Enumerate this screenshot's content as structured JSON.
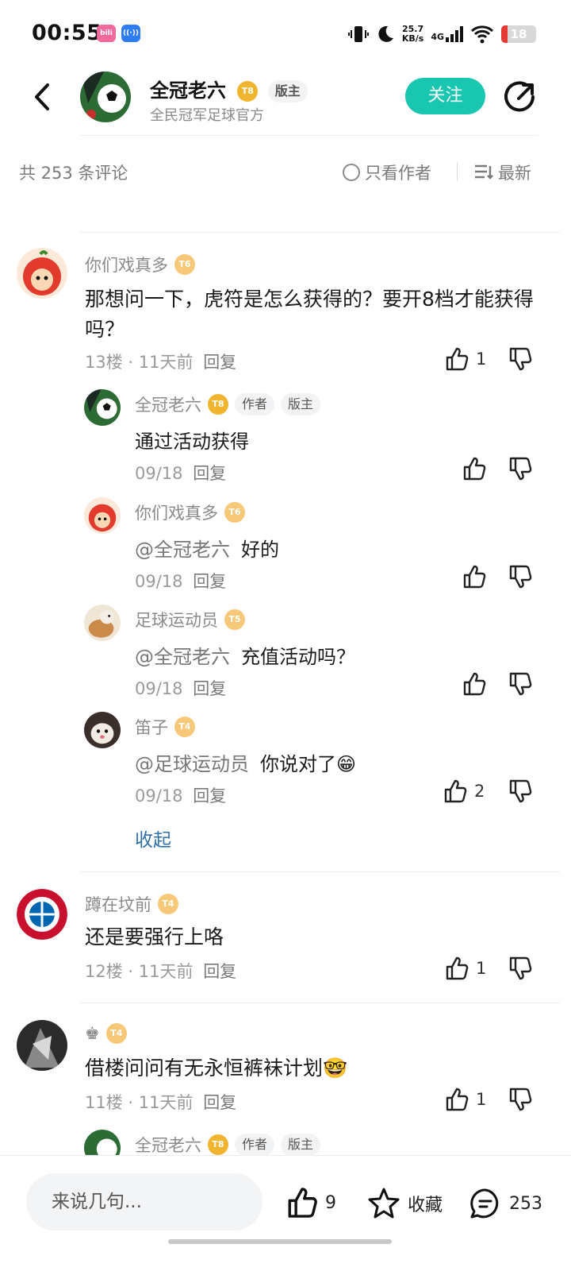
{
  "status_bar": {
    "time": "00:55",
    "apps": [
      "bilibili-icon",
      "hotspot-icon"
    ],
    "speed_value": "25.7",
    "speed_unit": "KB/s",
    "network": "4G",
    "battery": "18",
    "battery_level": 0.18,
    "battery_color": "#e53935"
  },
  "header": {
    "name": "全冠老六",
    "level_badge": "T8",
    "role_badge": "版主",
    "subtitle": "全民冠军足球官方",
    "follow_label": "关注",
    "accent": "#19c6b0"
  },
  "toolbar": {
    "count_text": "共 253 条评论",
    "only_author": "只看作者",
    "sort_label": "最新"
  },
  "comments": [
    {
      "user": "你们戏真多",
      "level": "T6",
      "text": "那想问一下，虎符是怎么获得的？要开8档才能获得吗？",
      "floor": "13楼",
      "time": "11天前",
      "reply_label": "回复",
      "likes": "1"
    },
    {
      "user": "蹲在坟前",
      "level": "T4",
      "text": "还是要强行上咯",
      "floor": "12楼",
      "time": "11天前",
      "reply_label": "回复",
      "likes": "1"
    },
    {
      "user": "♚",
      "level": "T4",
      "text": "借楼问问有无永恒裤袜计划🤓",
      "floor": "11楼",
      "time": "11天前",
      "reply_label": "回复",
      "likes": "1"
    }
  ],
  "replies": [
    {
      "user": "全冠老六",
      "level": "T8",
      "badges": [
        "作者",
        "版主"
      ],
      "at": "",
      "text": "通过活动获得",
      "date": "09/18",
      "reply_label": "回复",
      "likes": ""
    },
    {
      "user": "你们戏真多",
      "level": "T6",
      "badges": [],
      "at": "@全冠老六",
      "text": "好的",
      "date": "09/18",
      "reply_label": "回复",
      "likes": ""
    },
    {
      "user": "足球运动员",
      "level": "T5",
      "badges": [],
      "at": "@全冠老六",
      "text": "充值活动吗？",
      "date": "09/18",
      "reply_label": "回复",
      "likes": ""
    },
    {
      "user": "笛子",
      "level": "T4",
      "badges": [],
      "at": "@足球运动员",
      "text": "你说对了😁",
      "date": "09/18",
      "reply_label": "回复",
      "likes": "2"
    }
  ],
  "collapse_label": "收起",
  "partial_reply": {
    "user": "全冠老六",
    "level": "T8",
    "badges": [
      "作者",
      "版主"
    ]
  },
  "bottom_bar": {
    "input_placeholder": "来说几句...",
    "like_count": "9",
    "favorite_label": "收藏",
    "comment_count": "253"
  }
}
